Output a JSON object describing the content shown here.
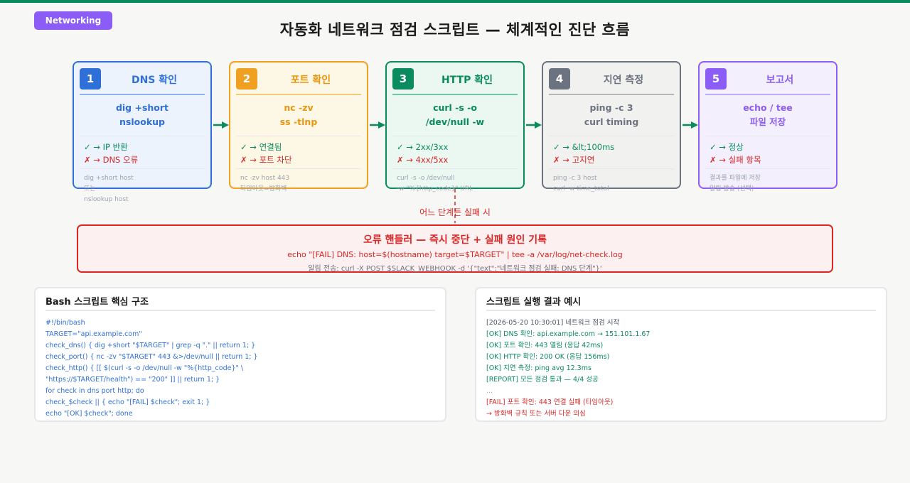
{
  "tag": "Networking",
  "title": "자동화 네트워크 점검 스크립트 — 체계적인 진단 흐름",
  "steps": [
    {
      "num": "1",
      "title": "DNS 확인",
      "cmd1": "dig +short",
      "cmd2": "nslookup",
      "ok": "✓ → IP 반환",
      "err": "✗ → DNS 오류",
      "note1": "dig +short host",
      "note2": "또는",
      "note3": "nslookup host"
    },
    {
      "num": "2",
      "title": "포트 확인",
      "cmd1": "nc -zv",
      "cmd2": "ss -tlnp",
      "ok": "✓ → 연결됨",
      "err": "✗ → 포트 차단",
      "note1": "nc -zv host 443",
      "note2": "타임아웃=방화벽",
      "note3": ""
    },
    {
      "num": "3",
      "title": "HTTP 확인",
      "cmd1": "curl -s -o",
      "cmd2": "/dev/null -w",
      "ok": "✓ → 2xx/3xx",
      "err": "✗ → 4xx/5xx",
      "note1": "curl -s -o /dev/null",
      "note2": "-w \"%{http_code}\" URL",
      "note3": ""
    },
    {
      "num": "4",
      "title": "지연 측정",
      "cmd1": "ping -c 3",
      "cmd2": "curl timing",
      "ok": "✓ → &lt;100ms",
      "err": "✗ → 고지연",
      "note1": "ping -c 3 host",
      "note2": "curl -w time_total",
      "note3": ""
    },
    {
      "num": "5",
      "title": "보고서",
      "cmd1": "echo / tee",
      "cmd2": "파일 저장",
      "ok": "✓ → 정상",
      "err": "✗ → 실패 항목",
      "note1": "결과를 파일에 저장",
      "note2": "알림 발송 (선택)",
      "note3": ""
    }
  ],
  "fail_label": "어느 단계든 실패 시",
  "handler": {
    "title": "오류 핸들러 — 즉시 중단 + 실패 원인 기록",
    "cmd": "echo \"[FAIL] DNS: host=$(hostname) target=$TARGET\" | tee -a /var/log/net-check.log",
    "alert": "알림 전송: curl -X POST $SLACK_WEBHOOK -d '{\"text\":\"네트워크 점검 실패: DNS 단계\"}'"
  },
  "script_panel": {
    "title": "Bash 스크립트 핵심 구조",
    "lines": [
      "#!/bin/bash",
      "TARGET=\"api.example.com\"",
      "check_dns() { dig +short \"$TARGET\" | grep -q \".\" || return 1; }",
      "check_port() { nc -zv \"$TARGET\" 443 &>/dev/null || return 1; }",
      "check_http() { [[ $(curl -s -o /dev/null -w \"%{http_code}\" \\",
      "\"https://$TARGET/health\") == \"200\" ]] || return 1; }",
      "for check in dns port http; do",
      "check_$check || { echo \"[FAIL] $check\"; exit 1; }",
      "echo \"[OK] $check\"; done"
    ]
  },
  "result_panel": {
    "title": "스크립트 실행 결과 예시",
    "lines": [
      {
        "text": "[2026-05-20 10:30:01] 네트워크 점검 시작",
        "kind": "plain"
      },
      {
        "text": "[OK] DNS 확인: api.example.com → 151.101.1.67",
        "kind": "ok"
      },
      {
        "text": "[OK] 포트 확인: 443 열림 (응답 42ms)",
        "kind": "ok"
      },
      {
        "text": "[OK] HTTP 확인: 200 OK (응답 156ms)",
        "kind": "ok"
      },
      {
        "text": "[OK] 지연 측정: ping avg 12.3ms",
        "kind": "ok"
      },
      {
        "text": "[REPORT] 모든 점검 통과 — 4/4 성공",
        "kind": "ok"
      },
      {
        "text": "...",
        "kind": "dim"
      },
      {
        "text": "[FAIL] 포트 확인: 443 연결 실패 (타임아웃)",
        "kind": "err"
      },
      {
        "text": "→ 방화벽 규칙 또는 서버 다운 의심",
        "kind": "err"
      }
    ]
  },
  "colors": {
    "accent": "#0a8a5f",
    "error": "#dc2626",
    "dns": "#2f6fd8",
    "port": "#f0a020",
    "latency": "#6b7280",
    "report": "#8b5cf6"
  }
}
